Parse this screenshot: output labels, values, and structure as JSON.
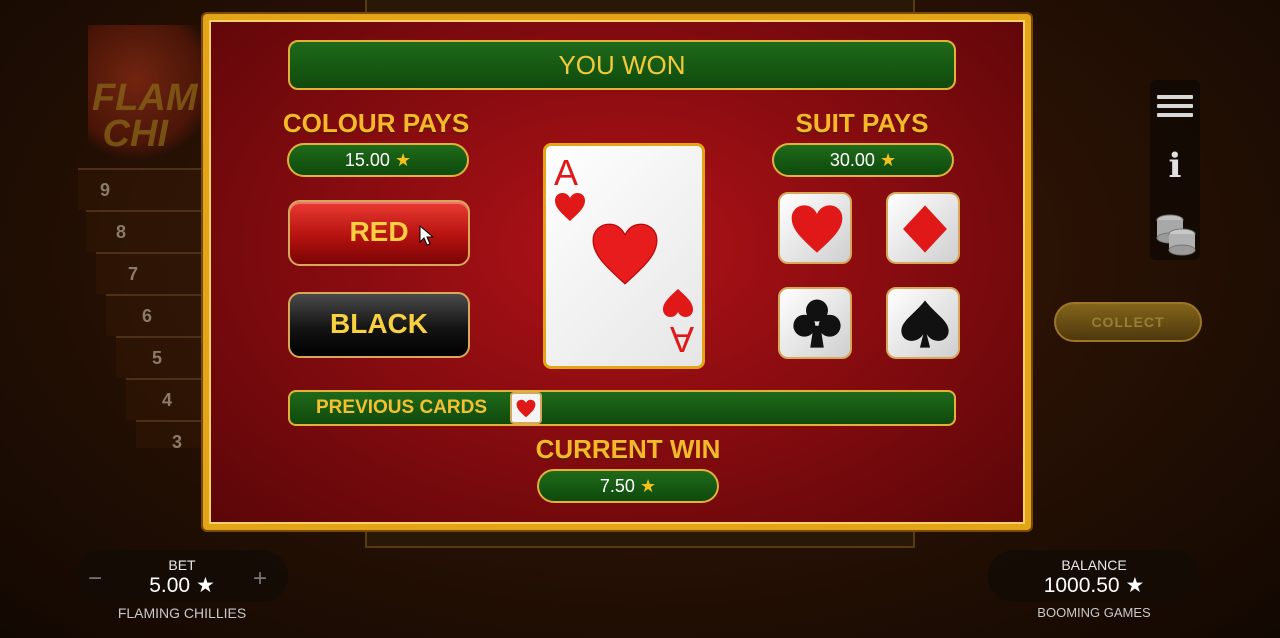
{
  "background": {
    "logo_text": "FLAMING CHILLIES",
    "ladder": [
      "9",
      "8",
      "7",
      "6",
      "5",
      "4",
      "3"
    ],
    "collect_label": "COLLECT"
  },
  "modal": {
    "banner": "YOU WON",
    "colour_pays": {
      "title": "COLOUR PAYS",
      "value": "15.00"
    },
    "suit_pays": {
      "title": "SUIT PAYS",
      "value": "30.00"
    },
    "buttons": {
      "red": "RED",
      "black": "BLACK"
    },
    "card": {
      "rank": "A",
      "suit": "hearts"
    },
    "suits": [
      "hearts-icon",
      "diamonds-icon",
      "clubs-icon",
      "spades-icon"
    ],
    "previous_cards": {
      "label": "PREVIOUS CARDS",
      "cards": [
        "hearts"
      ]
    },
    "current_win": {
      "title": "CURRENT WIN",
      "value": "7.50"
    }
  },
  "hud": {
    "bet_label": "BET",
    "bet_value": "5.00",
    "minus": "−",
    "plus": "+",
    "game_name": "FLAMING CHILLIES",
    "balance_label": "BALANCE",
    "balance_value": "1000.50",
    "provider": "BOOMING GAMES"
  },
  "colors": {
    "gold": "#e3a418",
    "felt_green": "#1f6a1a",
    "modal_red": "#b01218",
    "suit_red": "#e01818"
  }
}
